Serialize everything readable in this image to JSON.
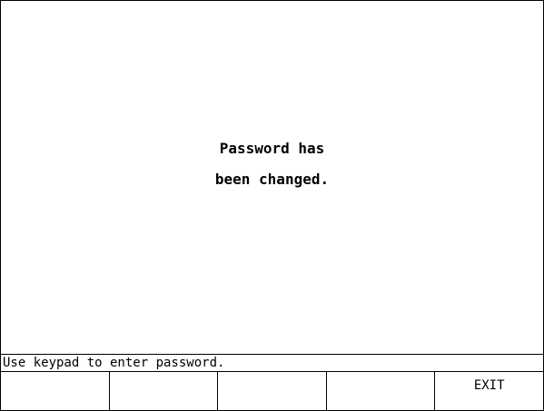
{
  "message": {
    "line1": "Password has",
    "line2": "been changed."
  },
  "status": {
    "text": "Use keypad to enter password."
  },
  "softkeys": [
    {
      "label": ""
    },
    {
      "label": ""
    },
    {
      "label": ""
    },
    {
      "label": ""
    },
    {
      "label": "EXIT"
    }
  ]
}
